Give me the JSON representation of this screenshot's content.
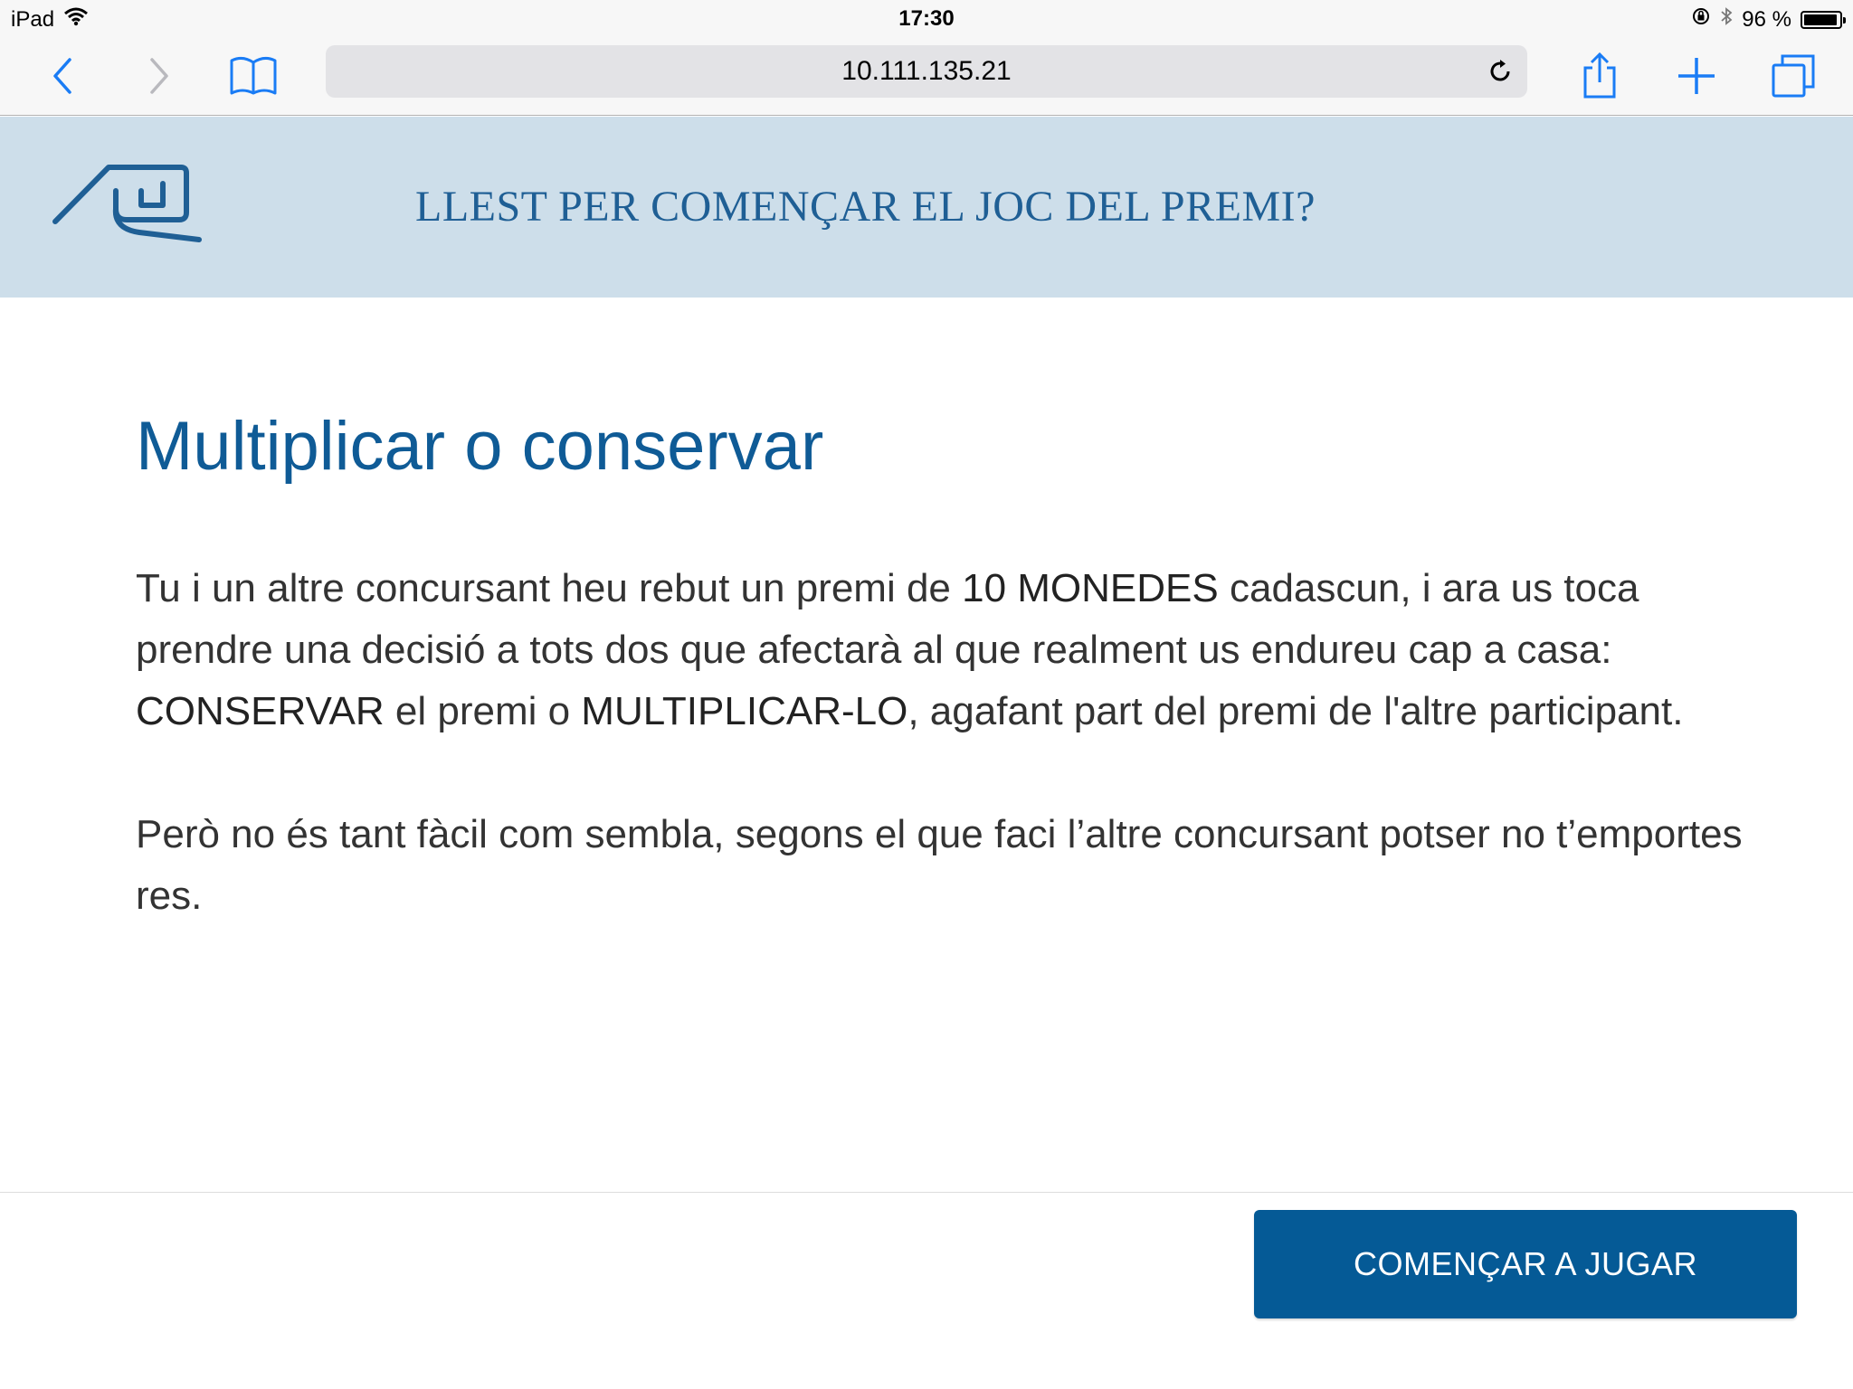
{
  "status_bar": {
    "device": "iPad",
    "time": "17:30",
    "battery": "96 %",
    "battery_level": 0.96,
    "icons": [
      "wifi-icon",
      "orientation-lock-icon",
      "bluetooth-icon",
      "battery-icon"
    ]
  },
  "browser": {
    "url": "10.111.135.21",
    "icons": [
      "back-icon",
      "forward-icon",
      "bookmarks-icon",
      "reload-icon",
      "share-icon",
      "new-tab-icon",
      "tabs-icon"
    ],
    "accent_color": "#1a7cf5"
  },
  "header": {
    "title": "LLEST PER COMENÇAR EL JOC DEL PREMI?",
    "background": "#cddeea",
    "title_color": "#1f5f95"
  },
  "main": {
    "heading": "Multiplicar o conservar",
    "p1_a": "Tu i un altre concursant heu rebut un premi de ",
    "p1_b": "10 MONEDES",
    "p1_c": " cadascun, i ara us toca prendre una decisió a tots dos que afectarà al que realment us endureu cap a casa: ",
    "p1_d": "CONSERVAR",
    "p1_e": " el premi o ",
    "p1_f": "MULTIPLICAR-LO",
    "p1_g": ", agafant part del premi de l'altre participant.",
    "p2": "Però no és tant fàcil com sembla, segons el que faci l’altre concursant potser no t’emportes res."
  },
  "footer": {
    "button_label": "COMENÇAR A JUGAR",
    "button_color": "#055a96"
  }
}
